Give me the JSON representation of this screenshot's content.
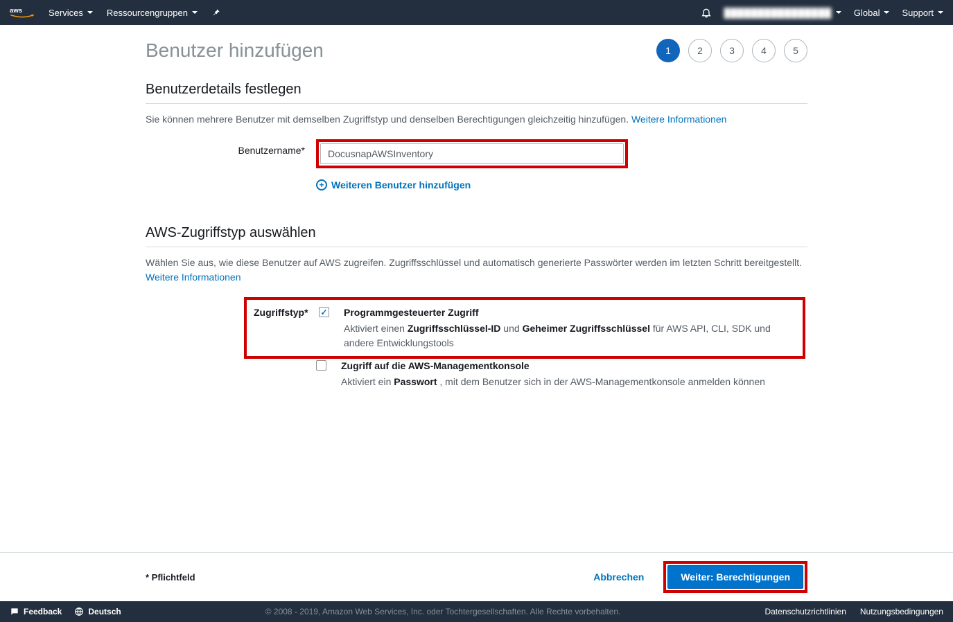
{
  "nav": {
    "services": "Services",
    "resource_groups": "Ressourcengruppen",
    "region": "Global",
    "support": "Support",
    "account_masked": "████████████████"
  },
  "page": {
    "title": "Benutzer hinzufügen",
    "steps": [
      "1",
      "2",
      "3",
      "4",
      "5"
    ]
  },
  "section1": {
    "heading": "Benutzerdetails festlegen",
    "desc": "Sie können mehrere Benutzer mit demselben Zugriffstyp und denselben Berechtigungen gleichzeitig hinzufügen.",
    "more_info": "Weitere Informationen",
    "username_label": "Benutzername*",
    "username_value": "DocusnapAWSInventory",
    "add_another": "Weiteren Benutzer hinzufügen"
  },
  "section2": {
    "heading": "AWS-Zugriffstyp auswählen",
    "desc": "Wählen Sie aus, wie diese Benutzer auf AWS zugreifen. Zugriffsschlüssel und automatisch generierte Passwörter werden im letzten Schritt bereitgestellt.",
    "more_info": "Weitere Informationen",
    "label": "Zugriffstyp*",
    "opt1_title": "Programmgesteuerter Zugriff",
    "opt1_pre": "Aktiviert einen ",
    "opt1_b1": "Zugriffsschlüssel-ID",
    "opt1_mid": " und ",
    "opt1_b2": "Geheimer Zugriffsschlüssel",
    "opt1_post": " für AWS API, CLI, SDK und andere Entwicklungstools",
    "opt2_title": "Zugriff auf die AWS-Managementkonsole",
    "opt2_pre": "Aktiviert ein ",
    "opt2_b1": "Passwort",
    "opt2_post": " , mit dem Benutzer sich in der AWS-Managementkonsole anmelden können"
  },
  "actions": {
    "required_note": "* Pflichtfeld",
    "cancel": "Abbrechen",
    "next": "Weiter: Berechtigungen"
  },
  "footer": {
    "feedback": "Feedback",
    "language": "Deutsch",
    "copyright": "© 2008 - 2019, Amazon Web Services, Inc. oder Tochtergesellschaften. Alle Rechte vorbehalten.",
    "privacy": "Datenschutzrichtlinien",
    "terms": "Nutzungsbedingungen"
  }
}
